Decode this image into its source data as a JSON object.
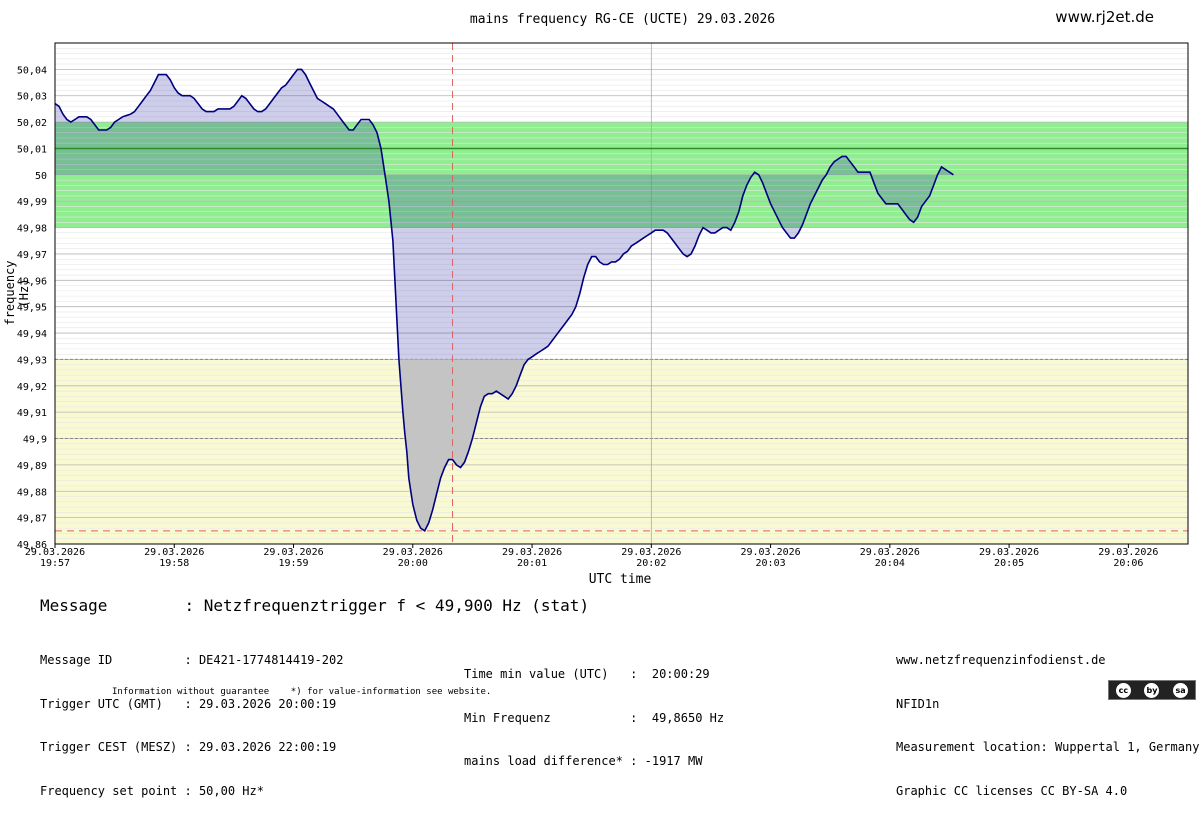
{
  "header": {
    "title": "mains frequency RG-CE (UCTE) 29.03.2026",
    "site": "www.rj2et.de"
  },
  "chart_data": {
    "type": "area",
    "title": "mains frequency RG-CE (UCTE) 29.03.2026",
    "xlabel": "UTC time",
    "ylabel": "mains frequency (Hz)",
    "ylim": [
      49.86,
      50.05
    ],
    "xlim": [
      "19:57:00",
      "20:06:30"
    ],
    "yticks": [
      "49,86",
      "49,87",
      "49,88",
      "49,89",
      "49,9",
      "49,91",
      "49,92",
      "49,93",
      "49,94",
      "49,95",
      "49,96",
      "49,97",
      "49,98",
      "49,99",
      "50",
      "50,01",
      "50,02",
      "50,03",
      "50,04"
    ],
    "xticks": [
      {
        "date": "29.03.2026",
        "time": "19:57"
      },
      {
        "date": "29.03.2026",
        "time": "19:58"
      },
      {
        "date": "29.03.2026",
        "time": "19:59"
      },
      {
        "date": "29.03.2026",
        "time": "20:00"
      },
      {
        "date": "29.03.2026",
        "time": "20:01"
      },
      {
        "date": "29.03.2026",
        "time": "20:02"
      },
      {
        "date": "29.03.2026",
        "time": "20:03"
      },
      {
        "date": "29.03.2026",
        "time": "20:04"
      },
      {
        "date": "29.03.2026",
        "time": "20:05"
      },
      {
        "date": "29.03.2026",
        "time": "20:06"
      }
    ],
    "bands": [
      {
        "range": [
          49.98,
          50.02
        ],
        "color": "#90ee90"
      },
      {
        "range": [
          49.86,
          49.93
        ],
        "color": "#fafad2"
      }
    ],
    "setpoint": 50.0,
    "reference_line": {
      "value": 50.01,
      "color": "#2e8b2e"
    },
    "min_marker": {
      "time": "20:00:20",
      "value": 49.865,
      "color": "#e06060"
    },
    "series": [
      {
        "color": "#000080",
        "points": [
          [
            "19:57:00",
            50.027
          ],
          [
            "19:57:02",
            50.026
          ],
          [
            "19:57:04",
            50.023
          ],
          [
            "19:57:06",
            50.021
          ],
          [
            "19:57:08",
            50.02
          ],
          [
            "19:57:10",
            50.021
          ],
          [
            "19:57:12",
            50.022
          ],
          [
            "19:57:16",
            50.022
          ],
          [
            "19:57:18",
            50.021
          ],
          [
            "19:57:20",
            50.019
          ],
          [
            "19:57:22",
            50.017
          ],
          [
            "19:57:26",
            50.017
          ],
          [
            "19:57:28",
            50.018
          ],
          [
            "19:57:30",
            50.02
          ],
          [
            "19:57:32",
            50.021
          ],
          [
            "19:57:34",
            50.022
          ],
          [
            "19:57:38",
            50.023
          ],
          [
            "19:57:40",
            50.024
          ],
          [
            "19:57:42",
            50.026
          ],
          [
            "19:57:44",
            50.028
          ],
          [
            "19:57:46",
            50.03
          ],
          [
            "19:57:48",
            50.032
          ],
          [
            "19:57:50",
            50.035
          ],
          [
            "19:57:52",
            50.038
          ],
          [
            "19:57:56",
            50.038
          ],
          [
            "19:57:58",
            50.036
          ],
          [
            "19:58:00",
            50.033
          ],
          [
            "19:58:02",
            50.031
          ],
          [
            "19:58:04",
            50.03
          ],
          [
            "19:58:08",
            50.03
          ],
          [
            "19:58:10",
            50.029
          ],
          [
            "19:58:12",
            50.027
          ],
          [
            "19:58:14",
            50.025
          ],
          [
            "19:58:16",
            50.024
          ],
          [
            "19:58:20",
            50.024
          ],
          [
            "19:58:22",
            50.025
          ],
          [
            "19:58:26",
            50.025
          ],
          [
            "19:58:28",
            50.025
          ],
          [
            "19:58:30",
            50.026
          ],
          [
            "19:58:32",
            50.028
          ],
          [
            "19:58:34",
            50.03
          ],
          [
            "19:58:36",
            50.029
          ],
          [
            "19:58:38",
            50.027
          ],
          [
            "19:58:40",
            50.025
          ],
          [
            "19:58:42",
            50.024
          ],
          [
            "19:58:44",
            50.024
          ],
          [
            "19:58:46",
            50.025
          ],
          [
            "19:58:48",
            50.027
          ],
          [
            "19:58:50",
            50.029
          ],
          [
            "19:58:52",
            50.031
          ],
          [
            "19:58:54",
            50.033
          ],
          [
            "19:58:56",
            50.034
          ],
          [
            "19:58:58",
            50.036
          ],
          [
            "19:59:00",
            50.038
          ],
          [
            "19:59:02",
            50.04
          ],
          [
            "19:59:04",
            50.04
          ],
          [
            "19:59:06",
            50.038
          ],
          [
            "19:59:08",
            50.035
          ],
          [
            "19:59:10",
            50.032
          ],
          [
            "19:59:12",
            50.029
          ],
          [
            "19:59:14",
            50.028
          ],
          [
            "19:59:16",
            50.027
          ],
          [
            "19:59:18",
            50.026
          ],
          [
            "19:59:20",
            50.025
          ],
          [
            "19:59:22",
            50.023
          ],
          [
            "19:59:24",
            50.021
          ],
          [
            "19:59:26",
            50.019
          ],
          [
            "19:59:28",
            50.017
          ],
          [
            "19:59:30",
            50.017
          ],
          [
            "19:59:32",
            50.019
          ],
          [
            "19:59:34",
            50.021
          ],
          [
            "19:59:38",
            50.021
          ],
          [
            "19:59:40",
            50.019
          ],
          [
            "19:59:42",
            50.016
          ],
          [
            "19:59:44",
            50.01
          ],
          [
            "19:59:46",
            50.0
          ],
          [
            "19:59:48",
            49.99
          ],
          [
            "19:59:50",
            49.975
          ],
          [
            "19:59:51",
            49.96
          ],
          [
            "19:59:52",
            49.945
          ],
          [
            "19:59:53",
            49.93
          ],
          [
            "19:59:54",
            49.92
          ],
          [
            "19:59:55",
            49.91
          ],
          [
            "19:59:56",
            49.902
          ],
          [
            "19:59:57",
            49.895
          ],
          [
            "19:59:58",
            49.885
          ],
          [
            "20:00:00",
            49.875
          ],
          [
            "20:00:02",
            49.869
          ],
          [
            "20:00:04",
            49.866
          ],
          [
            "20:00:06",
            49.865
          ],
          [
            "20:00:08",
            49.868
          ],
          [
            "20:00:10",
            49.873
          ],
          [
            "20:00:12",
            49.879
          ],
          [
            "20:00:14",
            49.885
          ],
          [
            "20:00:16",
            49.889
          ],
          [
            "20:00:18",
            49.892
          ],
          [
            "20:00:20",
            49.892
          ],
          [
            "20:00:22",
            49.89
          ],
          [
            "20:00:24",
            49.889
          ],
          [
            "20:00:26",
            49.891
          ],
          [
            "20:00:28",
            49.895
          ],
          [
            "20:00:30",
            49.9
          ],
          [
            "20:00:32",
            49.906
          ],
          [
            "20:00:34",
            49.912
          ],
          [
            "20:00:36",
            49.916
          ],
          [
            "20:00:38",
            49.917
          ],
          [
            "20:00:40",
            49.917
          ],
          [
            "20:00:42",
            49.918
          ],
          [
            "20:00:44",
            49.917
          ],
          [
            "20:00:46",
            49.916
          ],
          [
            "20:00:48",
            49.915
          ],
          [
            "20:00:50",
            49.917
          ],
          [
            "20:00:52",
            49.92
          ],
          [
            "20:00:54",
            49.924
          ],
          [
            "20:00:56",
            49.928
          ],
          [
            "20:00:58",
            49.93
          ],
          [
            "20:01:00",
            49.931
          ],
          [
            "20:01:02",
            49.932
          ],
          [
            "20:01:04",
            49.933
          ],
          [
            "20:01:06",
            49.934
          ],
          [
            "20:01:08",
            49.935
          ],
          [
            "20:01:10",
            49.937
          ],
          [
            "20:01:12",
            49.939
          ],
          [
            "20:01:14",
            49.941
          ],
          [
            "20:01:16",
            49.943
          ],
          [
            "20:01:18",
            49.945
          ],
          [
            "20:01:20",
            49.947
          ],
          [
            "20:01:22",
            49.95
          ],
          [
            "20:01:24",
            49.955
          ],
          [
            "20:01:26",
            49.961
          ],
          [
            "20:01:28",
            49.966
          ],
          [
            "20:01:30",
            49.969
          ],
          [
            "20:01:32",
            49.969
          ],
          [
            "20:01:34",
            49.967
          ],
          [
            "20:01:36",
            49.966
          ],
          [
            "20:01:38",
            49.966
          ],
          [
            "20:01:40",
            49.967
          ],
          [
            "20:01:42",
            49.967
          ],
          [
            "20:01:44",
            49.968
          ],
          [
            "20:01:46",
            49.97
          ],
          [
            "20:01:48",
            49.971
          ],
          [
            "20:01:50",
            49.973
          ],
          [
            "20:01:52",
            49.974
          ],
          [
            "20:01:54",
            49.975
          ],
          [
            "20:01:56",
            49.976
          ],
          [
            "20:01:58",
            49.977
          ],
          [
            "20:02:00",
            49.978
          ],
          [
            "20:02:02",
            49.979
          ],
          [
            "20:02:06",
            49.979
          ],
          [
            "20:02:08",
            49.978
          ],
          [
            "20:02:10",
            49.976
          ],
          [
            "20:02:12",
            49.974
          ],
          [
            "20:02:14",
            49.972
          ],
          [
            "20:02:16",
            49.97
          ],
          [
            "20:02:18",
            49.969
          ],
          [
            "20:02:20",
            49.97
          ],
          [
            "20:02:22",
            49.973
          ],
          [
            "20:02:24",
            49.977
          ],
          [
            "20:02:26",
            49.98
          ],
          [
            "20:02:28",
            49.979
          ],
          [
            "20:02:30",
            49.978
          ],
          [
            "20:02:32",
            49.978
          ],
          [
            "20:02:34",
            49.979
          ],
          [
            "20:02:36",
            49.98
          ],
          [
            "20:02:38",
            49.98
          ],
          [
            "20:02:40",
            49.979
          ],
          [
            "20:02:42",
            49.982
          ],
          [
            "20:02:44",
            49.986
          ],
          [
            "20:02:46",
            49.992
          ],
          [
            "20:02:48",
            49.996
          ],
          [
            "20:02:50",
            49.999
          ],
          [
            "20:02:52",
            50.001
          ],
          [
            "20:02:54",
            50.0
          ],
          [
            "20:02:56",
            49.997
          ],
          [
            "20:02:58",
            49.993
          ],
          [
            "20:03:00",
            49.989
          ],
          [
            "20:03:02",
            49.986
          ],
          [
            "20:03:04",
            49.983
          ],
          [
            "20:03:06",
            49.98
          ],
          [
            "20:03:08",
            49.978
          ],
          [
            "20:03:10",
            49.976
          ],
          [
            "20:03:12",
            49.976
          ],
          [
            "20:03:14",
            49.978
          ],
          [
            "20:03:16",
            49.981
          ],
          [
            "20:03:18",
            49.985
          ],
          [
            "20:03:20",
            49.989
          ],
          [
            "20:03:22",
            49.992
          ],
          [
            "20:03:24",
            49.995
          ],
          [
            "20:03:26",
            49.998
          ],
          [
            "20:03:28",
            50.0
          ],
          [
            "20:03:30",
            50.003
          ],
          [
            "20:03:32",
            50.005
          ],
          [
            "20:03:34",
            50.006
          ],
          [
            "20:03:36",
            50.007
          ],
          [
            "20:03:38",
            50.007
          ],
          [
            "20:03:40",
            50.005
          ],
          [
            "20:03:42",
            50.003
          ],
          [
            "20:03:44",
            50.001
          ],
          [
            "20:03:50",
            50.001
          ],
          [
            "20:03:52",
            49.997
          ],
          [
            "20:03:54",
            49.993
          ],
          [
            "20:03:56",
            49.991
          ],
          [
            "20:03:58",
            49.989
          ],
          [
            "20:04:04",
            49.989
          ],
          [
            "20:04:06",
            49.987
          ],
          [
            "20:04:08",
            49.985
          ],
          [
            "20:04:10",
            49.983
          ],
          [
            "20:04:12",
            49.982
          ],
          [
            "20:04:14",
            49.984
          ],
          [
            "20:04:16",
            49.988
          ],
          [
            "20:04:18",
            49.99
          ],
          [
            "20:04:20",
            49.992
          ],
          [
            "20:04:22",
            49.996
          ],
          [
            "20:04:24",
            50.0
          ],
          [
            "20:04:26",
            50.003
          ],
          [
            "20:04:28",
            50.002
          ],
          [
            "20:04:30",
            50.001
          ],
          [
            "20:04:32",
            50.0
          ]
        ]
      }
    ],
    "min_time_index": "20:00:06"
  },
  "message": {
    "title": "Message        : Netzfrequenztrigger f < 49,900 Hz (stat)",
    "left": [
      "Message ID          : DE421-1774814419-202",
      "Trigger UTC (GMT)   : 29.03.2026 20:00:19",
      "Trigger CEST (MESZ) : 29.03.2026 22:00:19",
      "Frequency set point : 50,00 Hz*"
    ],
    "middle": [
      "Time min value (UTC)   :  20:00:29",
      "Min Frequenz           :  49,8650 Hz",
      "mains load difference* : -1917 MW"
    ],
    "right": [
      "www.netzfrequenzinfodienst.de",
      "NFID1n",
      "Measurement location: Wuppertal 1, Germany",
      "Graphic CC licenses CC BY-SA 4.0"
    ],
    "footnote": "Information without guarantee    *) for value-information see website.",
    "license_badge": [
      "cc",
      "by",
      "sa"
    ]
  }
}
